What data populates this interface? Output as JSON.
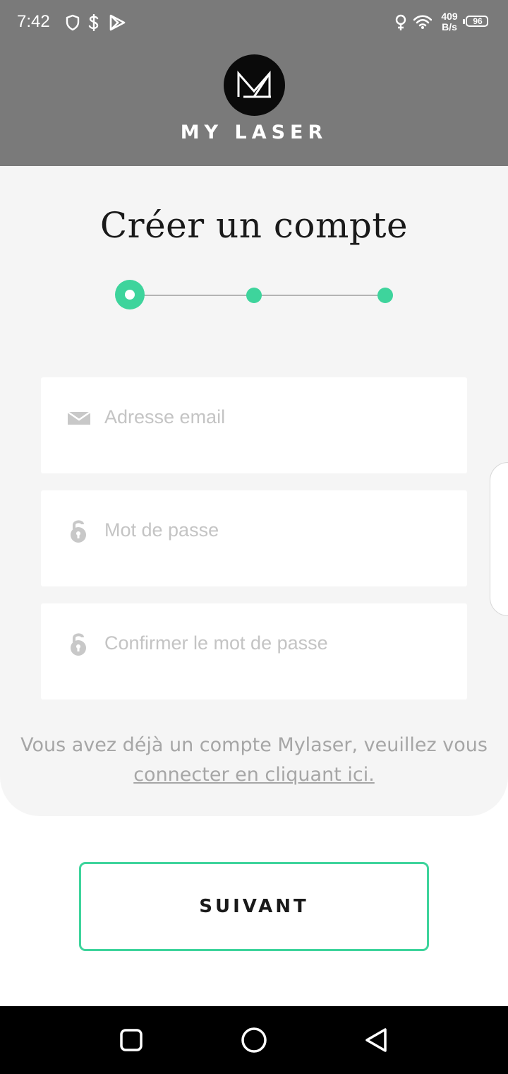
{
  "status_bar": {
    "time": "7:42",
    "net_speed_value": "409",
    "net_speed_unit": "B/s",
    "battery_level": "96",
    "icons": [
      "shield-icon",
      "dollar-icon",
      "play-store-icon",
      "location-icon",
      "wifi-icon",
      "battery-icon"
    ]
  },
  "header": {
    "brand_name": "MY LASER",
    "logo": "mylaser-logo-icon"
  },
  "form": {
    "title": "Créer un compte",
    "steps": {
      "total": 3,
      "current": 1
    },
    "email_placeholder": "Adresse email",
    "password_placeholder": "Mot de passe",
    "confirm_password_placeholder": "Confirmer le mot de passe",
    "login_hint": "Vous avez déjà un compte Mylaser, veuillez vous",
    "login_link": "connecter en cliquant ici."
  },
  "actions": {
    "next_label": "SUIVANT"
  },
  "navigation": {
    "buttons": [
      "recent-apps-icon",
      "home-icon",
      "back-icon"
    ]
  },
  "colors": {
    "accent": "#3ed49c",
    "header_bg": "#7a7a7a",
    "card_bg": "#f5f5f5"
  }
}
